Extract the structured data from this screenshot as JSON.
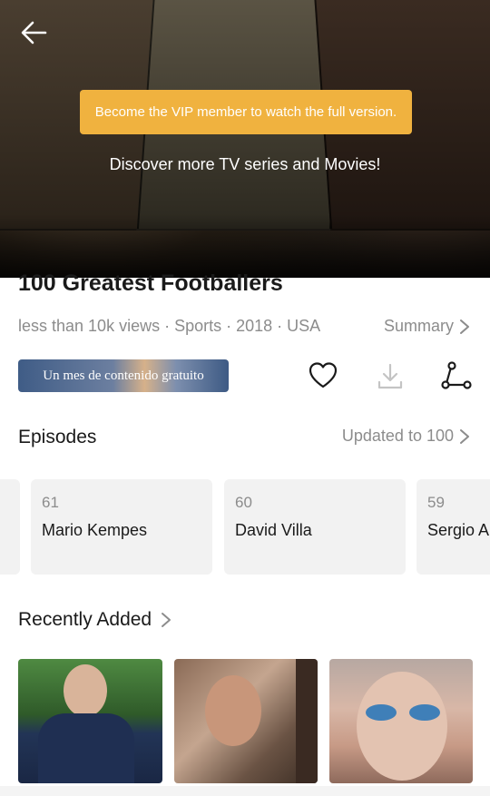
{
  "hero": {
    "vip_banner": "Become the VIP member to watch the full version.",
    "discover_text": "Discover more TV series and Movies!"
  },
  "show": {
    "title": "100 Greatest Footballers",
    "meta": "less than 10k views · Sports · 2018 · USA",
    "summary_label": "Summary",
    "promo_label": "Un mes de contenido gratuito"
  },
  "episodes": {
    "section_title": "Episodes",
    "updated_label": "Updated to 100",
    "items": [
      {
        "number": "61",
        "title": "Mario Kempes"
      },
      {
        "number": "60",
        "title": "David Villa"
      },
      {
        "number": "59",
        "title": "Sergio A"
      }
    ]
  },
  "recent": {
    "section_title": "Recently Added"
  },
  "colors": {
    "vip_banner": "#f0b23f",
    "text_primary": "#1a1a1a",
    "text_secondary": "#8c8c8c",
    "card_bg": "#f2f2f2"
  }
}
